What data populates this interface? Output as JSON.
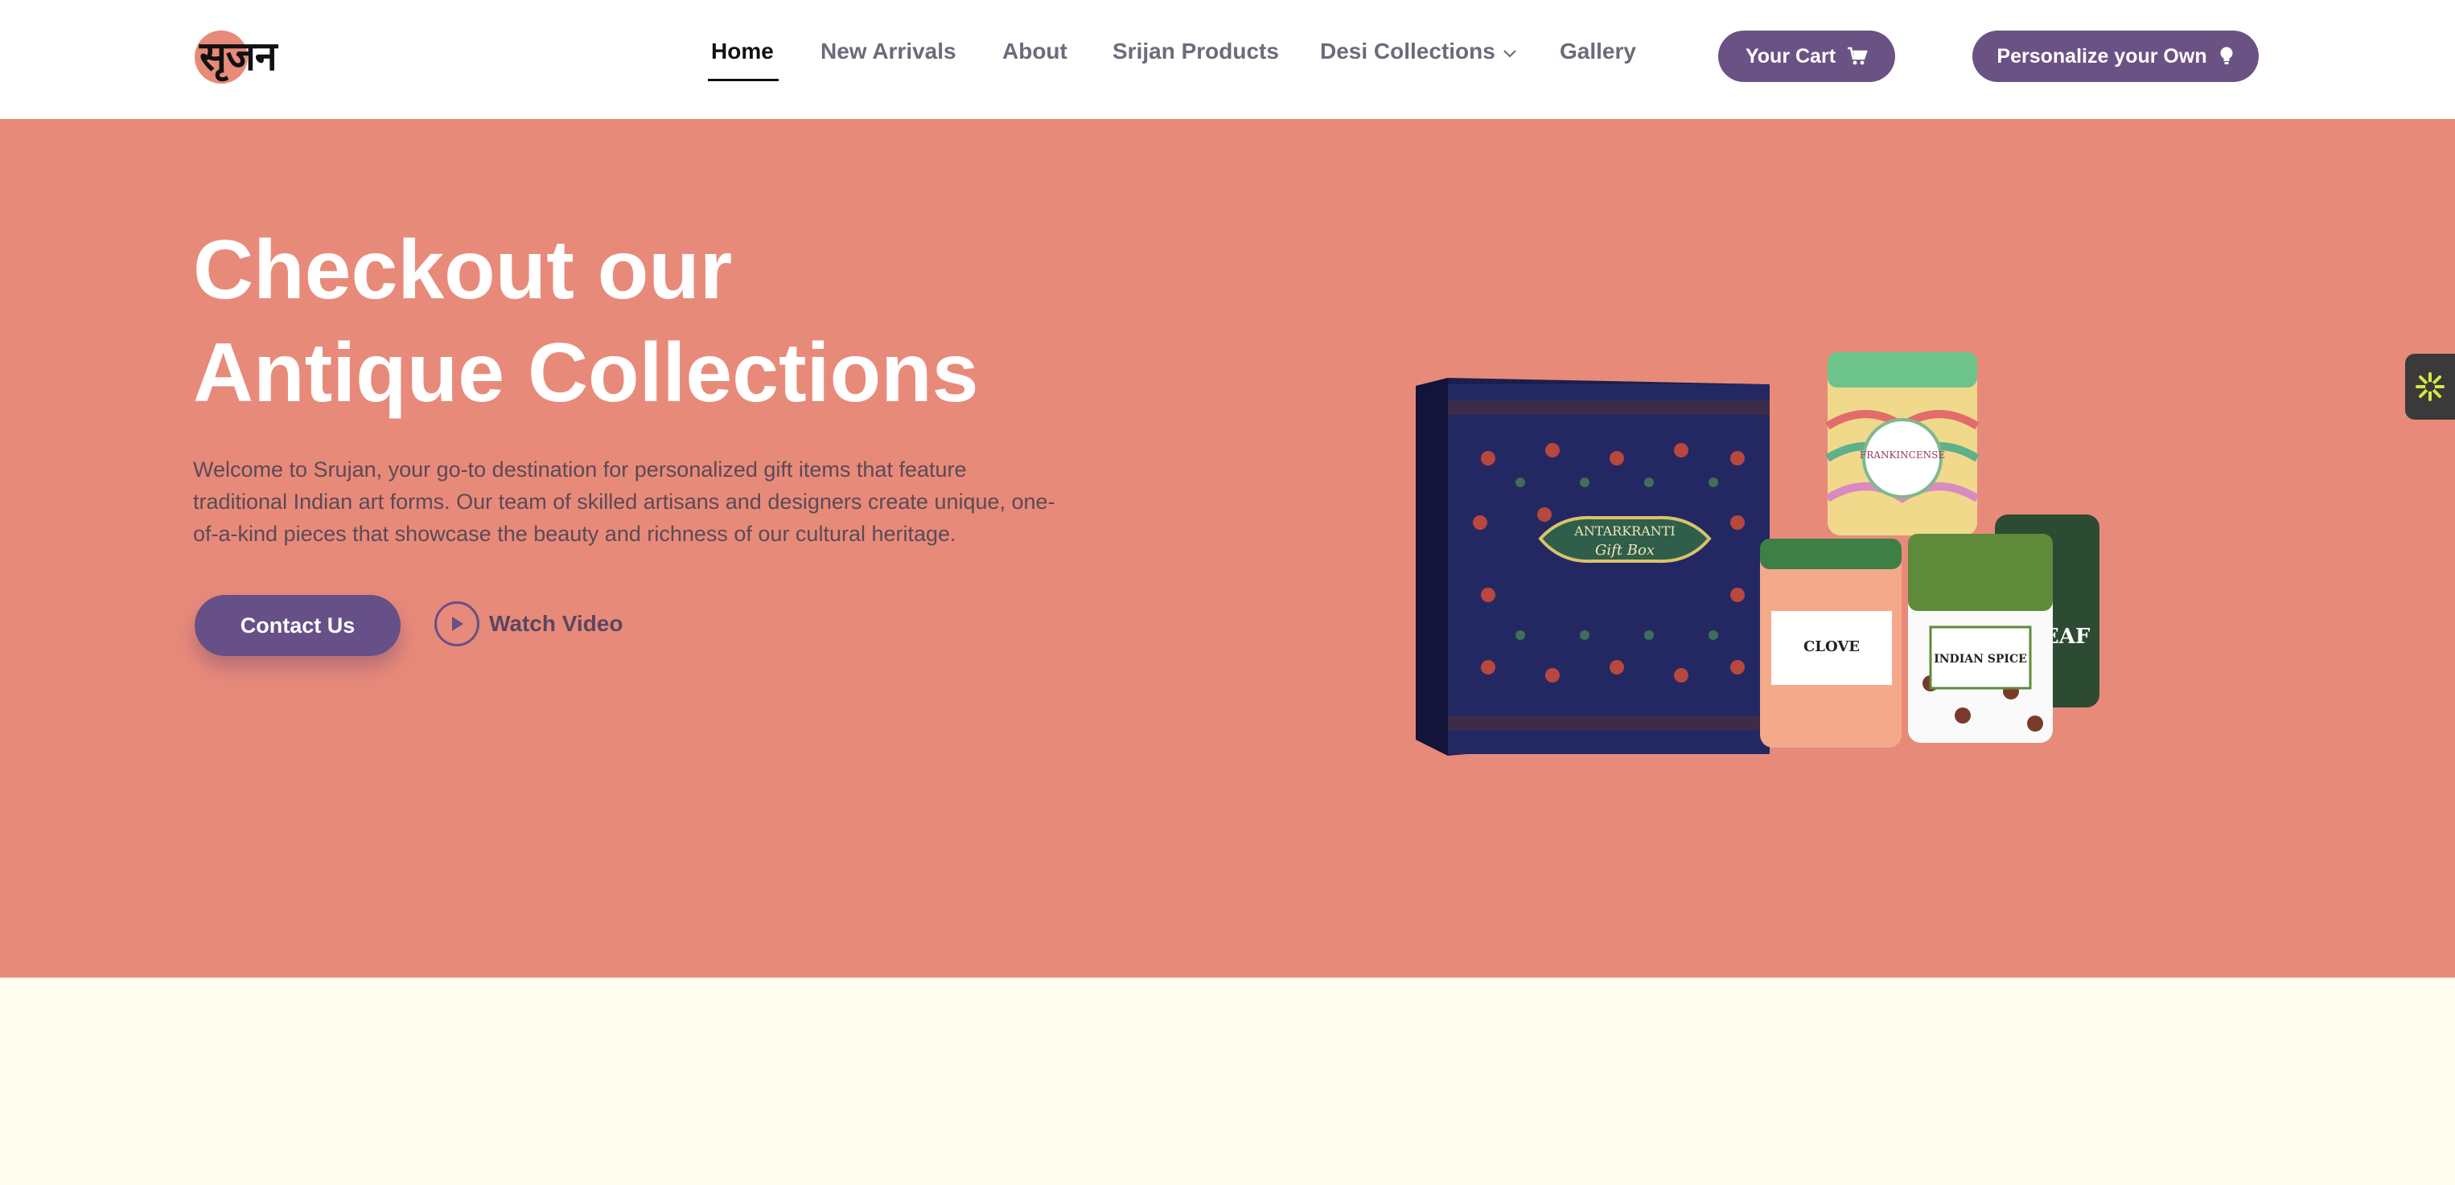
{
  "header": {
    "logo_text": "सृजन",
    "nav": [
      {
        "label": "Home",
        "active": true
      },
      {
        "label": "New Arrivals",
        "active": false
      },
      {
        "label": "About",
        "active": false
      },
      {
        "label": "Srijan Products",
        "active": false
      },
      {
        "label": "Desi Collections",
        "active": false,
        "has_dropdown": true
      },
      {
        "label": "Gallery",
        "active": false
      }
    ],
    "cart_button": {
      "label": "Your Cart",
      "icon": "cart-icon"
    },
    "personalize_button": {
      "label": "Personalize your Own",
      "icon": "lightbulb-icon"
    }
  },
  "hero": {
    "title_line1": "Checkout our",
    "title_line2": "Antique Collections",
    "description": "Welcome to Srujan, your go-to destination for personalized gift items that feature traditional Indian art forms. Our team of skilled artisans and designers create unique, one-of-a-kind pieces that showcase the beauty and richness of our cultural heritage.",
    "contact_button": "Contact Us",
    "watch_video": "Watch Video",
    "product_labels": {
      "box_brand": "ANTARKRANTI",
      "box_sub": "Gift Box",
      "jar1": "FRANKINCENSE",
      "jar2": "CLOVE",
      "jar3": "INDIAN SPICE",
      "jar4": "LEAF"
    }
  },
  "colors": {
    "hero_bg": "#e88a7a",
    "accent": "#6a5285",
    "lower_bg": "#fdfdf0"
  },
  "side_widget": {
    "icon": "sparkle-icon"
  }
}
